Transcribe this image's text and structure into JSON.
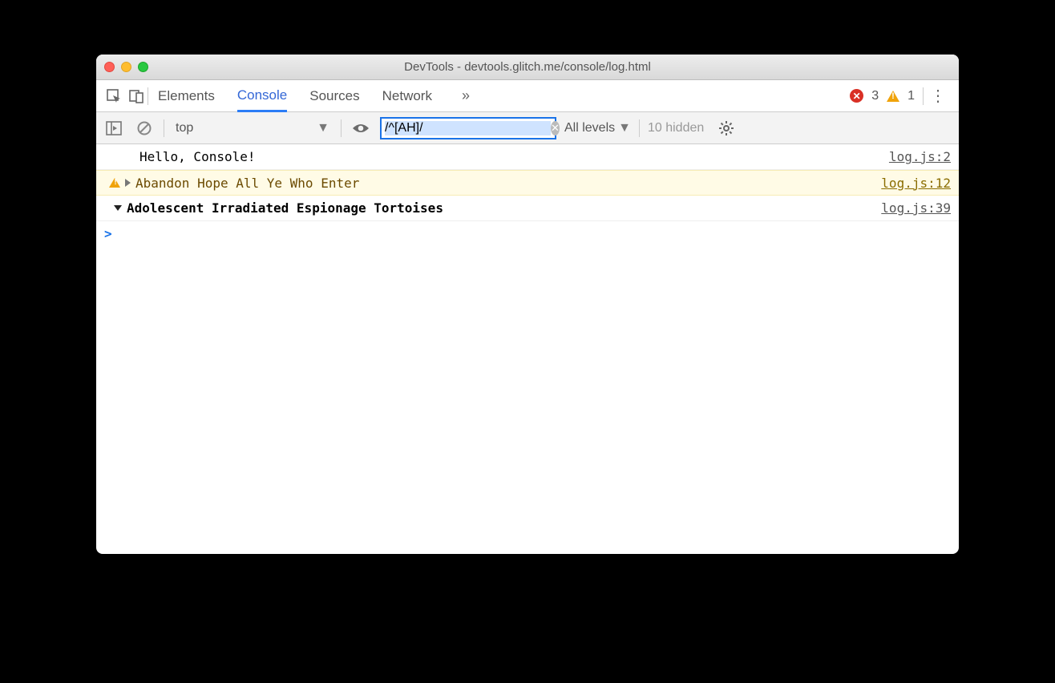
{
  "window_title": "DevTools - devtools.glitch.me/console/log.html",
  "tabs": {
    "elements": "Elements",
    "console": "Console",
    "sources": "Sources",
    "network": "Network"
  },
  "counts": {
    "errors": "3",
    "warnings": "1"
  },
  "filterbar": {
    "context": "top",
    "filter_value": "/^[AH]/",
    "levels_label": "All levels",
    "hidden_text": "10 hidden"
  },
  "messages": {
    "m0": {
      "text": "Hello, Console!",
      "source": "log.js:2"
    },
    "m1": {
      "text": "Abandon Hope All Ye Who Enter",
      "source": "log.js:12"
    },
    "m2": {
      "text": "Adolescent Irradiated Espionage Tortoises",
      "source": "log.js:39"
    }
  },
  "prompt": ">"
}
